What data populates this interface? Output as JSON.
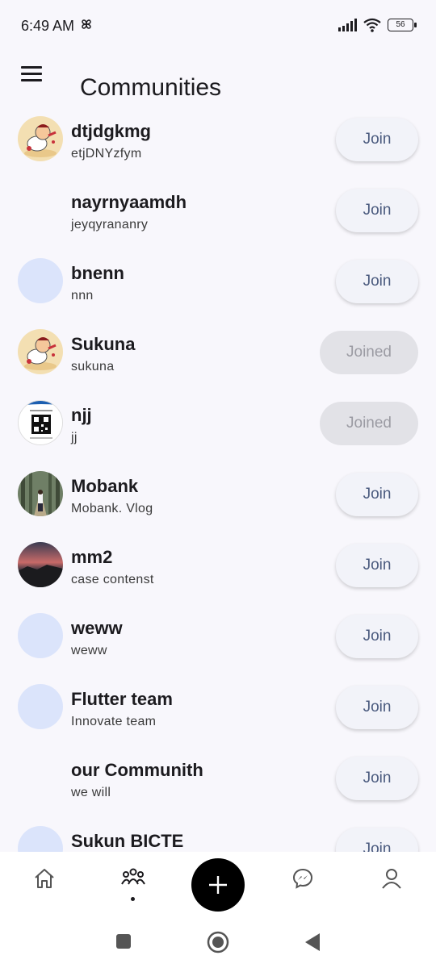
{
  "status_bar": {
    "time": "6:49 AM",
    "battery": "56",
    "icons": [
      "pinwheel-icon",
      "signal-icon",
      "wifi-icon",
      "battery-icon"
    ]
  },
  "app_bar": {
    "title": "Communities",
    "menu_icon": "hamburger-menu-icon"
  },
  "communities": [
    {
      "name": "dtjdgkmg",
      "subtitle": "etjDNYzfym",
      "action": "Join",
      "joined": false,
      "avatar": "cartoon-image"
    },
    {
      "name": "nayrnyaamdh",
      "subtitle": "jeyqyrananry",
      "action": "Join",
      "joined": false,
      "avatar": "none"
    },
    {
      "name": "bnenn",
      "subtitle": "nnn",
      "action": "Join",
      "joined": false,
      "avatar": "placeholder"
    },
    {
      "name": "Sukuna",
      "subtitle": "sukuna",
      "action": "Joined",
      "joined": true,
      "avatar": "cartoon-image"
    },
    {
      "name": "njj",
      "subtitle": "jj",
      "action": "Joined",
      "joined": true,
      "avatar": "qr-image"
    },
    {
      "name": "Mobank",
      "subtitle": "Mobank. Vlog",
      "action": "Join",
      "joined": false,
      "avatar": "forest-photo"
    },
    {
      "name": "mm2",
      "subtitle": "case contenst",
      "action": "Join",
      "joined": false,
      "avatar": "sunset-photo"
    },
    {
      "name": "weww",
      "subtitle": "weww",
      "action": "Join",
      "joined": false,
      "avatar": "placeholder"
    },
    {
      "name": "Flutter team",
      "subtitle": "Innovate team",
      "action": "Join",
      "joined": false,
      "avatar": "placeholder"
    },
    {
      "name": "our Communith",
      "subtitle": "we will",
      "action": "Join",
      "joined": false,
      "avatar": "none"
    },
    {
      "name": "Sukun BICTE",
      "subtitle": "",
      "action": "Join",
      "joined": false,
      "avatar": "placeholder"
    }
  ],
  "bottom_nav": {
    "items": [
      "home-icon",
      "communities-icon",
      "add-icon",
      "messenger-icon",
      "profile-icon"
    ],
    "active": "communities-icon"
  },
  "system_nav": [
    "recents-square-icon",
    "home-circle-icon",
    "back-triangle-icon"
  ],
  "colors": {
    "background": "#f8f7fc",
    "join_button": "#f2f3f9",
    "join_text": "#4a5a7e",
    "joined_button": "#e2e2e7",
    "joined_text": "#9b9ba3",
    "placeholder_avatar": "#dbe4fb",
    "fab": "#000000"
  }
}
